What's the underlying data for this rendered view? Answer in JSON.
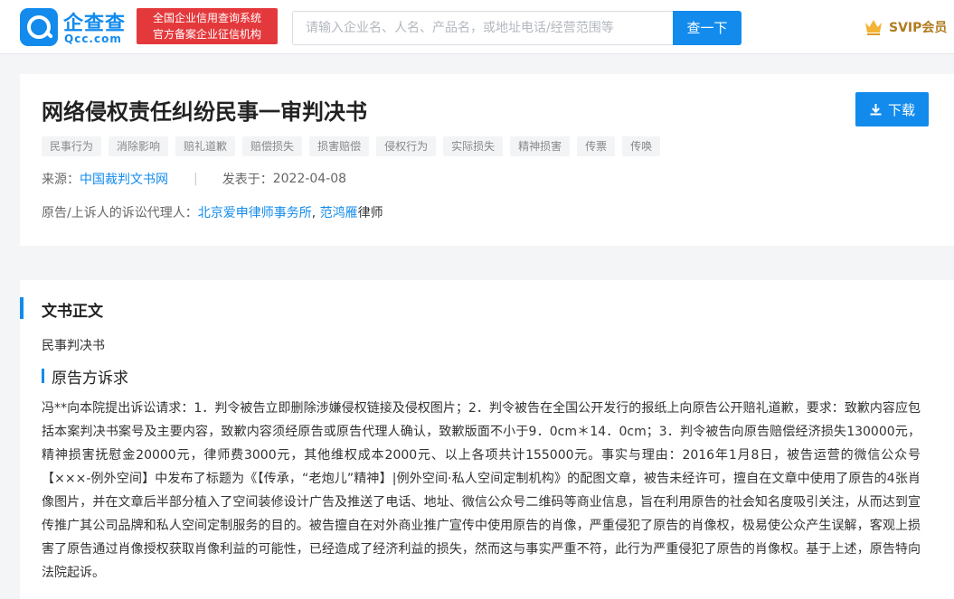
{
  "header": {
    "logo_cn": "企查查",
    "logo_en": "Qcc.com",
    "badge_lines": [
      "全国企业信用查询系统",
      "官方备案企业征信机构"
    ],
    "search_placeholder": "请输入企业名、人名、产品名，或地址电话/经营范围等",
    "search_button": "查一下",
    "svip_label": "SVIP会员"
  },
  "document": {
    "title": "网络侵权责任纠纷民事一审判决书",
    "download_label": "下载",
    "tags": [
      "民事行为",
      "消除影响",
      "赔礼道歉",
      "赔偿损失",
      "损害赔偿",
      "侵权行为",
      "实际损失",
      "精神损害",
      "传票",
      "传唤"
    ],
    "source_label": "来源：",
    "source_value": "中国裁判文书网",
    "date_label": "发表于：",
    "date_value": "2022-04-08",
    "agent_label": "原告/上诉人的诉讼代理人：",
    "agent_firm": "北京爱申律师事务所",
    "agent_comma": ", ",
    "agent_lawyer": "范鸿雁",
    "agent_suffix": "律师"
  },
  "content": {
    "section_title": "文书正文",
    "doc_type": "民事判决书",
    "sub_title": "原告方诉求",
    "body": "冯**向本院提出诉讼请求：1．判令被告立即删除涉嫌侵权链接及侵权图片；2．判令被告在全国公开发行的报纸上向原告公开赔礼道歉，要求：致歉内容应包括本案判决书案号及主要内容，致歉内容须经原告或原告代理人确认，致歉版面不小于9．0cm＊14．0cm；3．判令被告向原告赔偿经济损失130000元，精神损害抚慰金20000元，律师费3000元，其他维权成本2000元、以上各项共计155000元。事实与理由：2016年1月8日，被告运营的微信公众号【×××-例外空间】中发布了标题为《【传承，“老炮儿”精神】|例外空间·私人空间定制机构》的配图文章，被告未经许可，擅自在文章中使用了原告的4张肖像图片，并在文章后半部分植入了空间装修设计广告及推送了电话、地址、微信公众号二维码等商业信息，旨在利用原告的社会知名度吸引关注，从而达到宣传推广其公司品牌和私人空间定制服务的目的。被告擅自在对外商业推广宣传中使用原告的肖像，严重侵犯了原告的肖像权，极易使公众产生误解，客观上损害了原告通过肖像授权获取肖像利益的可能性，已经造成了经济利益的损失，然而这与事实严重不符，此行为严重侵犯了原告的肖像权。基于上述，原告特向法院起诉。"
  },
  "colors": {
    "brand_blue": "#128bed",
    "badge_red": "#e4393c",
    "svip_gold": "#b07c1f"
  },
  "icons": {
    "logo": "qcc-logo-icon",
    "crown": "crown-icon",
    "download": "download-icon"
  }
}
